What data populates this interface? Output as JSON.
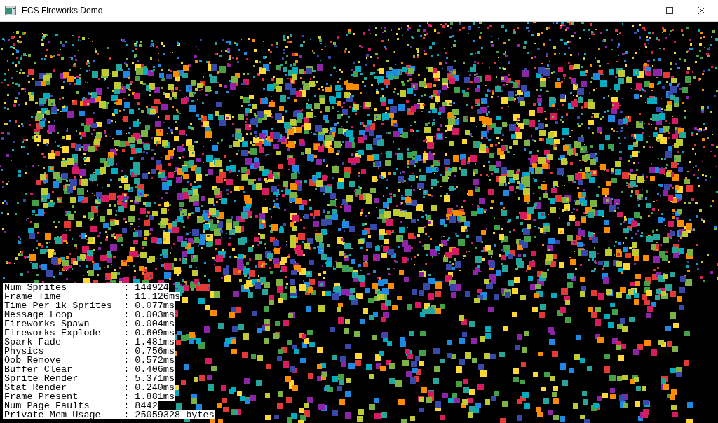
{
  "window": {
    "title": "ECS Fireworks Demo"
  },
  "stats": [
    {
      "text": "Num Sprites          : 144924"
    },
    {
      "text": "Frame Time           : 11.126ms"
    },
    {
      "text": "Time Per 1k Sprites  : 0.077ms"
    },
    {
      "text": "Message Loop         : 0.003ms"
    },
    {
      "text": "Fireworks Spawn      : 0.004ms"
    },
    {
      "text": "Fireworks Explode    : 0.609ms"
    },
    {
      "text": "Spark Fade           : 1.481ms"
    },
    {
      "text": "Physics              : 0.756ms"
    },
    {
      "text": "Oob Remove           : 0.572ms"
    },
    {
      "text": "Buffer Clear         : 0.406ms"
    },
    {
      "text": "Sprite Render        : 5.371ms"
    },
    {
      "text": "Stat Render          : 0.240ms"
    },
    {
      "text": "Frame Present        : 1.881ms"
    },
    {
      "text": "Num Page Faults      : 8442"
    },
    {
      "text": "Private Mem Usage    : 25059328 bytes"
    }
  ]
}
